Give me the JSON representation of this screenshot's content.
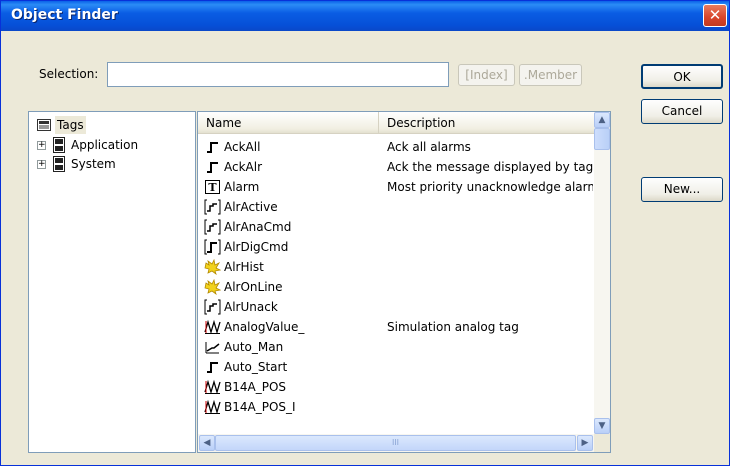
{
  "window": {
    "title": "Object Finder",
    "close_glyph": "✕"
  },
  "selection": {
    "label": "Selection:",
    "value": ""
  },
  "buttons": {
    "index": "[Index]",
    "member": ".Member",
    "ok": "OK",
    "cancel": "Cancel",
    "new": "New..."
  },
  "tree": {
    "root": "Tags",
    "children": [
      {
        "label": "Application",
        "expander": "+"
      },
      {
        "label": "System",
        "expander": "+"
      }
    ]
  },
  "list": {
    "columns": {
      "name": "Name",
      "description": "Description"
    },
    "rows": [
      {
        "name": "AckAll",
        "description": "Ack all alarms",
        "icon": "digital-step-icon"
      },
      {
        "name": "AckAlr",
        "description": "Ack the message displayed by tag \".",
        "icon": "digital-step-icon"
      },
      {
        "name": "Alarm",
        "description": "Most priority unacknowledge alarm",
        "icon": "text-tag-icon"
      },
      {
        "name": "AlrActive",
        "description": "",
        "icon": "framed-trend-icon"
      },
      {
        "name": "AlrAnaCmd",
        "description": "",
        "icon": "framed-trend-icon"
      },
      {
        "name": "AlrDigCmd",
        "description": "",
        "icon": "framed-digital-icon"
      },
      {
        "name": "AlrHist",
        "description": "",
        "icon": "alarm-spark-icon"
      },
      {
        "name": "AlrOnLine",
        "description": "",
        "icon": "alarm-spark-icon"
      },
      {
        "name": "AlrUnack",
        "description": "",
        "icon": "framed-trend-icon"
      },
      {
        "name": "AnalogValue_",
        "description": "Simulation analog tag",
        "icon": "analog-wave-icon"
      },
      {
        "name": "Auto_Man",
        "description": "",
        "icon": "analog-ramp-icon"
      },
      {
        "name": "Auto_Start",
        "description": "",
        "icon": "digital-step-icon"
      },
      {
        "name": "B14A_POS",
        "description": "",
        "icon": "analog-wave-icon"
      },
      {
        "name": "B14A_POS_I",
        "description": "",
        "icon": "analog-wave-icon"
      }
    ]
  },
  "scrollbar": {
    "up": "▲",
    "down": "▼",
    "left": "◀",
    "right": "▶",
    "grip": "III"
  },
  "colors": {
    "titlebar": "#0a5de4",
    "dialog_bg": "#ece9d8",
    "border": "#7f9db9",
    "close": "#d8442a"
  }
}
